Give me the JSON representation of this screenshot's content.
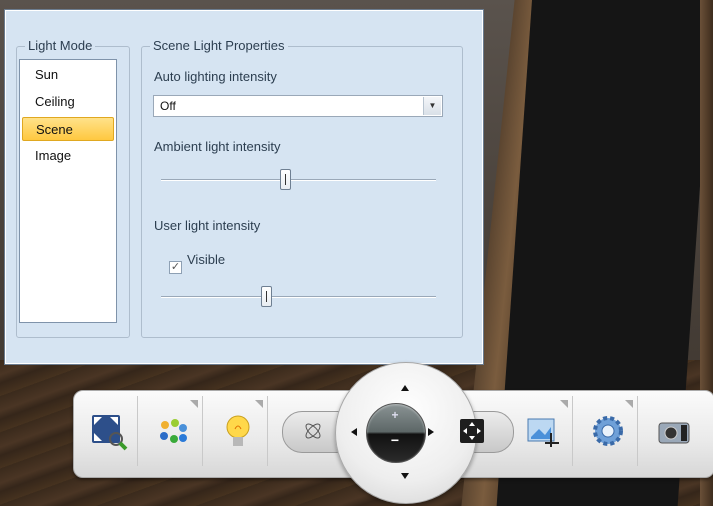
{
  "panel": {
    "light_mode": {
      "title": "Light Mode",
      "items": [
        "Sun",
        "Ceiling",
        "Scene",
        "Image"
      ],
      "selected": "Scene"
    },
    "scene_props": {
      "title": "Scene Light Properties",
      "auto_label": "Auto lighting intensity",
      "auto_value": "Off",
      "ambient_label": "Ambient light intensity",
      "ambient_level": 0.45,
      "user_label": "User light intensity",
      "visible_label": "Visible",
      "visible_checked": true,
      "user_level": 0.38
    }
  },
  "toolbar": {
    "buttons": [
      {
        "icon": "fit-view-icon"
      },
      {
        "icon": "materials-icon"
      },
      {
        "icon": "lightbulb-icon"
      },
      {
        "icon": "orbit-icon"
      },
      {
        "icon": "fullscreen-icon"
      },
      {
        "icon": "crop-image-icon"
      },
      {
        "icon": "gear-icon"
      },
      {
        "icon": "camera-icon"
      }
    ],
    "zoom_in": "+",
    "zoom_out": "−"
  },
  "colors": {
    "panel_bg": "#d6e4f2",
    "selected_item": "#ffc840"
  }
}
